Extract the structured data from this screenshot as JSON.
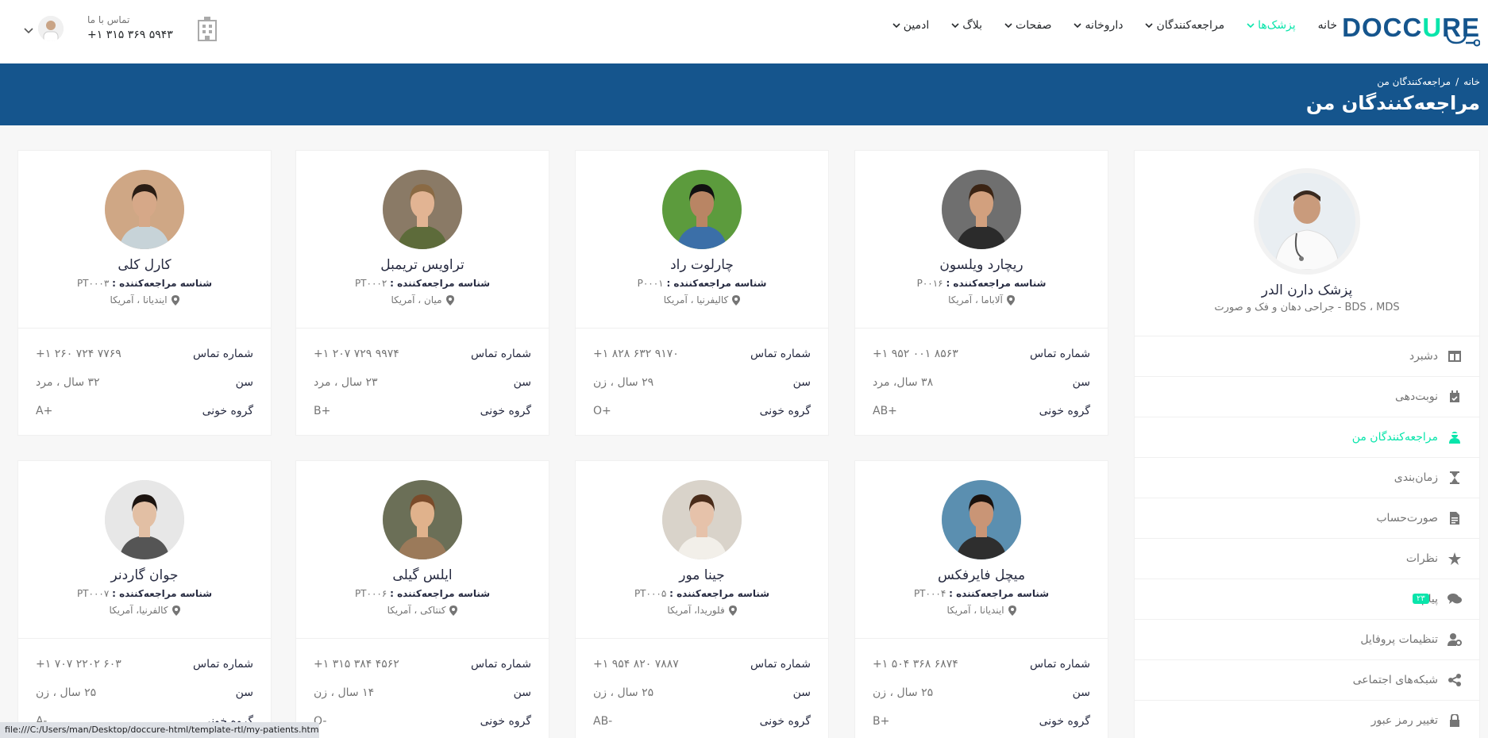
{
  "header": {
    "logo_text_1": "DOCC",
    "logo_text_2": "U",
    "logo_text_3": "RE",
    "nav": [
      {
        "label": "خانه",
        "chevron": false,
        "active": false
      },
      {
        "label": "پزشک‌ها",
        "chevron": true,
        "active": true
      },
      {
        "label": "مراجعه‌کنندگان",
        "chevron": true,
        "active": false
      },
      {
        "label": "داروخانه",
        "chevron": true,
        "active": false
      },
      {
        "label": "صفحات",
        "chevron": true,
        "active": false
      },
      {
        "label": "بلاگ",
        "chevron": true,
        "active": false
      },
      {
        "label": "ادمین",
        "chevron": true,
        "active": false
      }
    ],
    "contact_label": "تماس با ما",
    "contact_phone": "+۱ ۳۱۵ ۳۶۹ ۵۹۴۳"
  },
  "breadcrumb": {
    "home": "خانه",
    "separator": "/",
    "current": "مراجعه‌کنندگان من",
    "title": "مراجعه‌کنندگان من"
  },
  "sidebar": {
    "doctor_name": "پزشک دارن الدر",
    "doctor_spec": "BDS ، MDS - جراحی دهان و فک و صورت",
    "menu": [
      {
        "label": "دشبرد",
        "icon": "columns-icon",
        "active": false
      },
      {
        "label": "نوبت‌دهی",
        "icon": "calendar-check-icon",
        "active": false
      },
      {
        "label": "مراجعه‌کنندگان من",
        "icon": "user-injured-icon",
        "active": true
      },
      {
        "label": "زمان‌بندی",
        "icon": "hourglass-icon",
        "active": false
      },
      {
        "label": "صورت‌حساب",
        "icon": "invoice-icon",
        "active": false
      },
      {
        "label": "نظرات",
        "icon": "star-icon",
        "active": false
      },
      {
        "label": "پیام‌ها",
        "icon": "comments-icon",
        "active": false,
        "badge": "۲۳"
      },
      {
        "label": "تنظیمات پروفایل",
        "icon": "user-cog-icon",
        "active": false
      },
      {
        "label": "شبکه‌های اجتماعی",
        "icon": "share-icon",
        "active": false
      },
      {
        "label": "تغییر رمز عبور",
        "icon": "lock-icon",
        "active": false
      }
    ]
  },
  "labels": {
    "id": "شناسه مراجعه‌کننده :",
    "phone": "شماره تماس",
    "age": "سن",
    "blood": "گروه خونی"
  },
  "patients": [
    {
      "name": "ریچارد ویلسون",
      "id": "P۰۰۱۶",
      "location": "آلاباما ، آمریکا",
      "phone": "+۱ ۹۵۲ ۰۰۱ ۸۵۶۳",
      "age": "۳۸ سال، مرد",
      "blood": "AB+"
    },
    {
      "name": "چارلوت راد",
      "id": "P۰۰۰۱",
      "location": "کالیفرنیا ، آمریکا",
      "phone": "+۱ ۸۲۸ ۶۳۲ ۹۱۷۰",
      "age": "۲۹ سال ، زن",
      "blood": "O+"
    },
    {
      "name": "تراویس تریمبل",
      "id": "PT۰۰۰۲",
      "location": "میان ، آمریکا",
      "phone": "+۱ ۲۰۷ ۷۲۹ ۹۹۷۴",
      "age": "۲۳ سال ، مرد",
      "blood": "B+"
    },
    {
      "name": "کارل کلی",
      "id": "PT۰۰۰۳",
      "location": "ایندیانا ، آمریکا",
      "phone": "+۱ ۲۶۰ ۷۲۴ ۷۷۶۹",
      "age": "۳۲ سال ، مرد",
      "blood": "A+"
    },
    {
      "name": "میچل فایرفکس",
      "id": "PT۰۰۰۴",
      "location": "ایندیانا ، آمریکا",
      "phone": "+۱ ۵۰۴ ۳۶۸ ۶۸۷۴",
      "age": "۲۵ سال ، زن",
      "blood": "B+"
    },
    {
      "name": "جینا مور",
      "id": "PT۰۰۰۵",
      "location": "فلوریدا، آمریکا",
      "phone": "+۱ ۹۵۴ ۸۲۰ ۷۸۸۷",
      "age": "۲۵ سال ، زن",
      "blood": "AB-"
    },
    {
      "name": "ایلس گیلی",
      "id": "PT۰۰۰۶",
      "location": "کنتاکی ، آمریکا",
      "phone": "+۱ ۳۱۵ ۳۸۴ ۴۵۶۲",
      "age": "۱۴ سال ، زن",
      "blood": "O-"
    },
    {
      "name": "جوان گاردنر",
      "id": "PT۰۰۰۷",
      "location": "کالفرنیا، آمریکا",
      "phone": "+۱ ۷۰۷ ۲۲۰۲ ۶۰۳",
      "age": "۲۵ سال ، زن",
      "blood": "A-"
    }
  ],
  "status_url": "file:///C:/Users/man/Desktop/doccure-html/template-rtl/my-patients.html#",
  "colors": {
    "primary": "#15558d",
    "accent": "#09e5ab"
  }
}
